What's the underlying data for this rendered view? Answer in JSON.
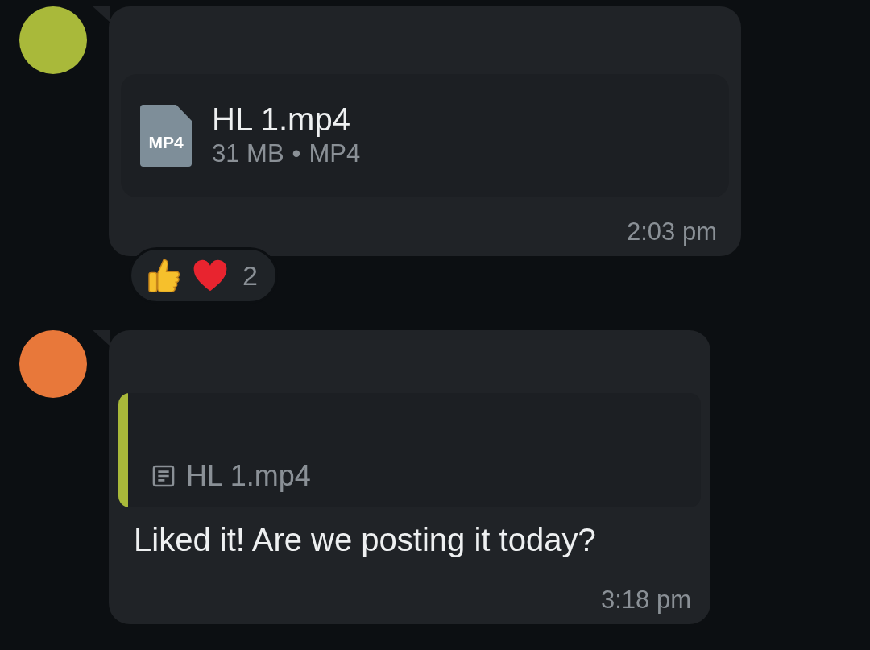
{
  "messages": [
    {
      "color": "#a9b93a",
      "kind": "file",
      "file": {
        "icon_label": "MP4",
        "name": "HL 1.mp4",
        "size": "31 MB",
        "separator": "•",
        "type": "MP4"
      },
      "time": "2:03 pm",
      "reactions": {
        "emojis": [
          {
            "kind": "thumbs-up"
          },
          {
            "kind": "heart"
          }
        ],
        "count": "2"
      }
    },
    {
      "color": "#e8783a",
      "kind": "reply",
      "quote": {
        "color": "#a9b93a",
        "file_name": "HL 1.mp4"
      },
      "text": "Liked it! Are we posting it today?",
      "time": "3:18 pm"
    }
  ]
}
